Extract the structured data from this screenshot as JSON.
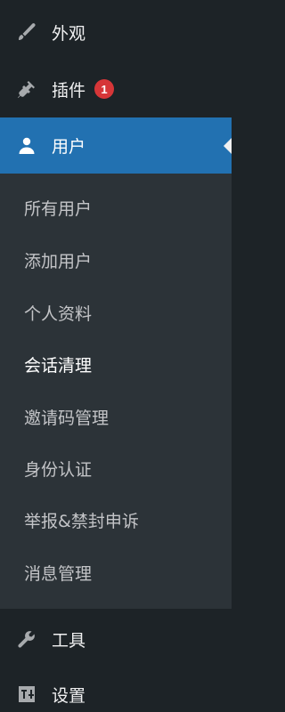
{
  "menu": {
    "appearance": {
      "label": "外观",
      "icon": "paintbrush-icon"
    },
    "plugins": {
      "label": "插件",
      "icon": "plugin-icon",
      "badge": "1",
      "badge_color": "#d63638"
    },
    "users": {
      "label": "用户",
      "icon": "user-icon",
      "active_color": "#2271b1"
    },
    "tools": {
      "label": "工具",
      "icon": "wrench-icon"
    },
    "settings": {
      "label": "设置",
      "icon": "settings-sliders-icon"
    }
  },
  "submenu": {
    "items": [
      {
        "label": "所有用户"
      },
      {
        "label": "添加用户"
      },
      {
        "label": "个人资料"
      },
      {
        "label": "会话清理"
      },
      {
        "label": "邀请码管理"
      },
      {
        "label": "身份认证"
      },
      {
        "label": "举报&禁封申诉"
      },
      {
        "label": "消息管理"
      }
    ]
  }
}
